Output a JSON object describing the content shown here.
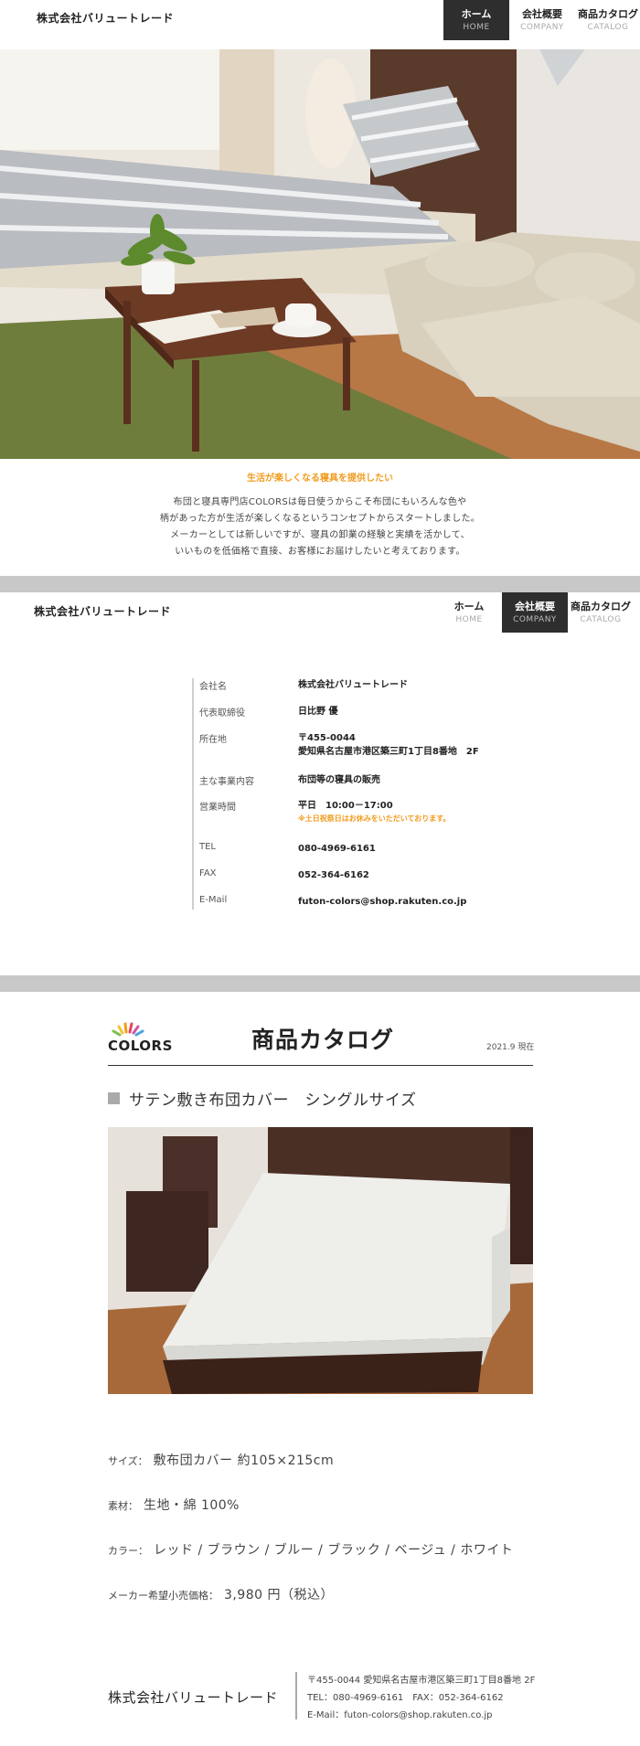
{
  "header": {
    "brand": "株式会社バリュートレード",
    "nav": [
      {
        "jp": "ホーム",
        "en": "HOME"
      },
      {
        "jp": "会社概要",
        "en": "COMPANY"
      },
      {
        "jp": "商品カタログ",
        "en": "CATALOG"
      }
    ]
  },
  "intro": {
    "title": "生活が楽しくなる寝具を提供したい",
    "lines": [
      "布団と寝具専門店COLORSは毎日使うからこそ布団にもいろんな色や",
      "柄があった方が生活が楽しくなるというコンセプトからスタートしました。",
      "メーカーとしては新しいですが、寝具の卸業の経験と実績を活かして、",
      "いいものを低価格で直接、お客様にお届けしたいと考えております。"
    ]
  },
  "company": {
    "rows": [
      {
        "label": "会社名",
        "value": "株式会社バリュートレード"
      },
      {
        "label": "代表取締役",
        "value": "日比野 優"
      },
      {
        "label": "所在地",
        "value": "〒455-0044",
        "value2": "愛知県名古屋市港区築三町1丁目8番地　2F"
      },
      {
        "label": "主な事業内容",
        "value": "布団等の寝具の販売"
      },
      {
        "label": "営業時間",
        "value": "平日　10:00－17:00",
        "note": "※土日祝祭日はお休みをいただいております。"
      },
      {
        "label": "TEL",
        "value": "080-4969-6161"
      },
      {
        "label": "FAX",
        "value": "052-364-6162"
      },
      {
        "label": "E-Mail",
        "value": "futon-colors@shop.rakuten.co.jp"
      }
    ]
  },
  "catalog": {
    "logo": "COLORS",
    "title": "商品カタログ",
    "date": "2021.9 現在",
    "product_name": "サテン敷き布団カバー　シングルサイズ",
    "specs": [
      {
        "key": "サイズ：",
        "value": "敷布団カバー 約105×215cm"
      },
      {
        "key": "素材：",
        "value": "生地・綿 100%"
      },
      {
        "key": "カラー：",
        "value": "レッド / ブラウン / ブルー / ブラック / ベージュ / ホワイト"
      },
      {
        "key": "メーカー希望小売価格：",
        "value": "3,980 円（税込）"
      }
    ]
  },
  "footer": {
    "brand": "株式会社バリュートレード",
    "address": "〒455-0044 愛知県名古屋市港区築三町1丁目8番地 2F",
    "telfax": "TEL：080-4969-6161　FAX：052-364-6162",
    "email": "E-Mail：futon-colors@shop.rakuten.co.jp"
  },
  "colors": {
    "accent": "#f29b1d",
    "nav_active": "#2e2e2e",
    "band": "#c8c8c8"
  }
}
